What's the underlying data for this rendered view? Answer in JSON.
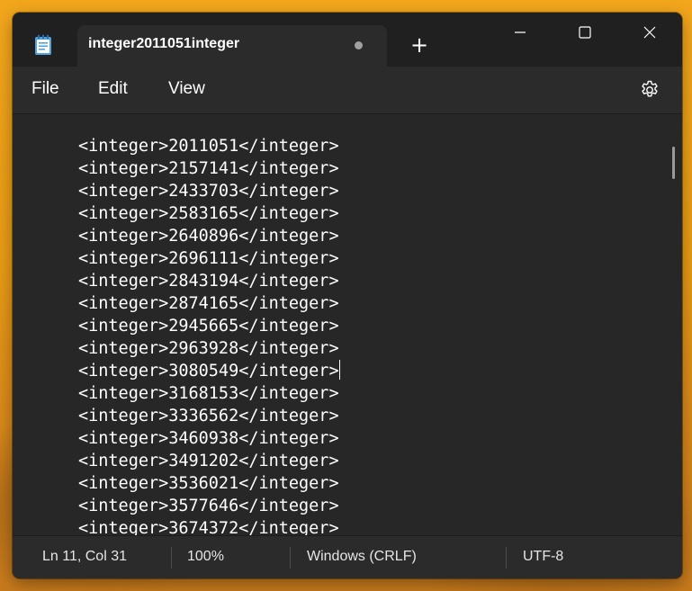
{
  "window": {
    "tab_title": "integer2011051integer",
    "new_tab_label": "+",
    "app_icon": "notepad-icon"
  },
  "menu": {
    "file": "File",
    "edit": "Edit",
    "view": "View",
    "settings_icon": "gear-icon"
  },
  "editor": {
    "lines": [
      "<integer>2011051</integer>",
      "<integer>2157141</integer>",
      "<integer>2433703</integer>",
      "<integer>2583165</integer>",
      "<integer>2640896</integer>",
      "<integer>2696111</integer>",
      "<integer>2843194</integer>",
      "<integer>2874165</integer>",
      "<integer>2945665</integer>",
      "<integer>2963928</integer>",
      "<integer>3080549</integer>",
      "<integer>3168153</integer>",
      "<integer>3336562</integer>",
      "<integer>3460938</integer>",
      "<integer>3491202</integer>",
      "<integer>3536021</integer>",
      "<integer>3577646</integer>",
      "<integer>3674372</integer>"
    ]
  },
  "status": {
    "position": "Ln 11, Col 31",
    "zoom": "100%",
    "line_ending": "Windows (CRLF)",
    "encoding": "UTF-8"
  }
}
